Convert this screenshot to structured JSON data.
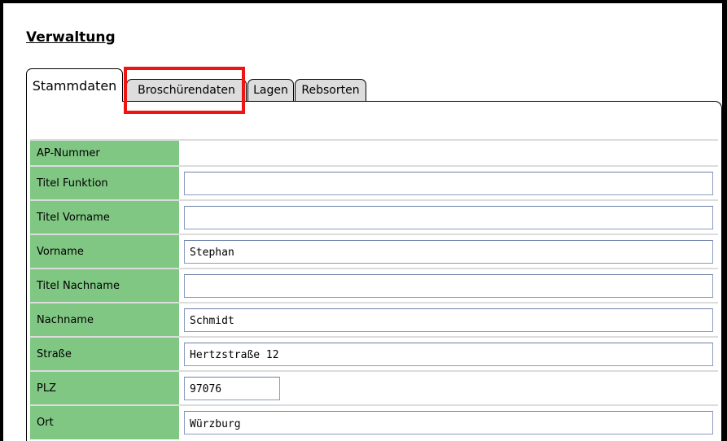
{
  "page": {
    "title": "Verwaltung"
  },
  "tabs": [
    {
      "label": "Stammdaten",
      "active": true
    },
    {
      "label": "Broschürendaten",
      "active": false,
      "highlighted": true
    },
    {
      "label": "Lagen",
      "active": false
    },
    {
      "label": "Rebsorten",
      "active": false
    }
  ],
  "form": {
    "rows": [
      {
        "label": "AP-Nummer",
        "value": ""
      },
      {
        "label": "Titel Funktion",
        "value": ""
      },
      {
        "label": "Titel Vorname",
        "value": ""
      },
      {
        "label": "Vorname",
        "value": "Stephan"
      },
      {
        "label": "Titel Nachname",
        "value": ""
      },
      {
        "label": "Nachname",
        "value": "Schmidt"
      },
      {
        "label": "Straße",
        "value": "Hertzstraße 12"
      },
      {
        "label": "PLZ",
        "value": "97076"
      },
      {
        "label": "Ort",
        "value": "Würzburg"
      }
    ]
  },
  "colors": {
    "label_background": "#80c783",
    "highlight_border": "#ee1414",
    "frame": "#000000"
  }
}
